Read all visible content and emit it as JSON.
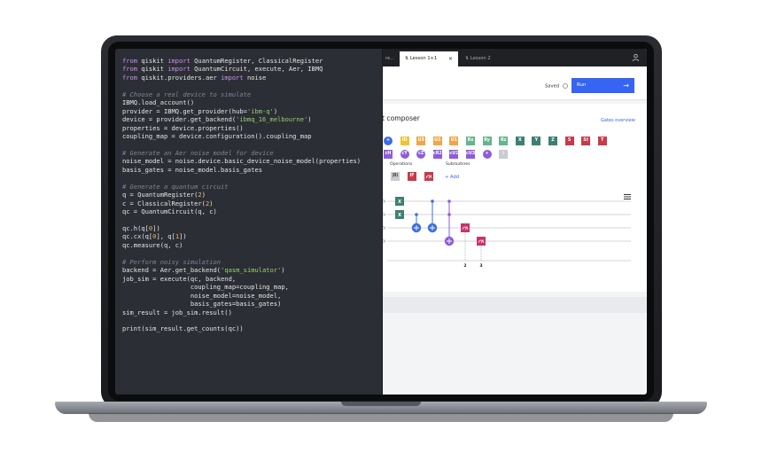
{
  "editor": {
    "code_lines": [
      [
        [
          "kw",
          "from"
        ],
        [
          "p",
          " qiskit "
        ],
        [
          "kw",
          "import"
        ],
        [
          "p",
          " QuantumRegister, ClassicalRegister"
        ]
      ],
      [
        [
          "kw",
          "from"
        ],
        [
          "p",
          " qiskit "
        ],
        [
          "kw",
          "import"
        ],
        [
          "p",
          " QuantumCircuit, execute, Aer, IBMQ"
        ]
      ],
      [
        [
          "kw",
          "from"
        ],
        [
          "p",
          " qiskit.providers.aer "
        ],
        [
          "kw",
          "import"
        ],
        [
          "p",
          " noise"
        ]
      ],
      [],
      [
        [
          "cm",
          "# Choose a real device to simulate"
        ]
      ],
      [
        [
          "p",
          "IBMQ.load_account()"
        ]
      ],
      [
        [
          "p",
          "provider = IBMQ.get_provider(hub="
        ],
        [
          "st",
          "'ibm-q'"
        ],
        [
          "p",
          ")"
        ]
      ],
      [
        [
          "p",
          "device = provider.get_backend("
        ],
        [
          "st",
          "'ibmq_16_melbourne'"
        ],
        [
          "p",
          ")"
        ]
      ],
      [
        [
          "p",
          "properties = device.properties()"
        ]
      ],
      [
        [
          "p",
          "coupling_map = device.configuration().coupling_map"
        ]
      ],
      [],
      [
        [
          "cm",
          "# Generate an Aer noise model for device"
        ]
      ],
      [
        [
          "p",
          "noise_model = noise.device.basic_device_noise_model(properties)"
        ]
      ],
      [
        [
          "p",
          "basis_gates = noise_model.basis_gates"
        ]
      ],
      [],
      [
        [
          "cm",
          "# Generate a quantum circuit"
        ]
      ],
      [
        [
          "p",
          "q = QuantumRegister("
        ],
        [
          "num",
          "2"
        ],
        [
          "p",
          ")"
        ]
      ],
      [
        [
          "p",
          "c = ClassicalRegister("
        ],
        [
          "num",
          "2"
        ],
        [
          "p",
          ")"
        ]
      ],
      [
        [
          "p",
          "qc = QuantumCircuit(q, c)"
        ]
      ],
      [],
      [
        [
          "p",
          "qc.h(q["
        ],
        [
          "num",
          "0"
        ],
        [
          "p",
          "])"
        ]
      ],
      [
        [
          "p",
          "qc.cx(q["
        ],
        [
          "num",
          "0"
        ],
        [
          "p",
          "], q["
        ],
        [
          "num",
          "1"
        ],
        [
          "p",
          "])"
        ]
      ],
      [
        [
          "p",
          "qc.measure(q, c)"
        ]
      ],
      [],
      [
        [
          "cm",
          "# Perform noisy simulation"
        ]
      ],
      [
        [
          "p",
          "backend = Aer.get_backend("
        ],
        [
          "st",
          "'qasm_simulator'"
        ],
        [
          "p",
          ")"
        ]
      ],
      [
        [
          "p",
          "job_sim = execute(qc, backend,"
        ]
      ],
      [
        [
          "p",
          "                  coupling_map=coupling_map,"
        ]
      ],
      [
        [
          "p",
          "                  noise_model=noise_model,"
        ]
      ],
      [
        [
          "p",
          "                  basis_gates=basis_gates)"
        ]
      ],
      [
        [
          "p",
          "sim_result = job_sim.result()"
        ]
      ],
      [],
      [
        [
          "p",
          "print(sim_result.get_counts(qc))"
        ]
      ]
    ]
  },
  "composer": {
    "tabs": [
      {
        "label": "re...",
        "active": false
      },
      {
        "label": "Lesson 1+1",
        "active": true,
        "close": "×"
      },
      {
        "label": "Lesson 2",
        "active": false
      }
    ],
    "saved_label": "Saved",
    "run_label": "Run",
    "title": "t composer",
    "gates_link": "Gates overview",
    "gate_row1": [
      {
        "label": "+",
        "color": "#3e6de0",
        "round": true
      },
      {
        "label": "ID",
        "color": "#f1c232",
        "round": false
      },
      {
        "label": "U3",
        "color": "#f1a64a",
        "round": false
      },
      {
        "label": "U2",
        "color": "#f1a64a",
        "round": false
      },
      {
        "label": "U1",
        "color": "#f1a64a",
        "round": false
      },
      {
        "label": "Rx",
        "color": "#67b48f",
        "round": false
      },
      {
        "label": "Ry",
        "color": "#67b48f",
        "round": false
      },
      {
        "label": "Rz",
        "color": "#67b48f",
        "round": false
      },
      {
        "label": "X",
        "color": "#3f7f73",
        "round": false
      },
      {
        "label": "Y",
        "color": "#3f7f73",
        "round": false
      },
      {
        "label": "Z",
        "color": "#3f7f73",
        "round": false
      },
      {
        "label": "S",
        "color": "#c73a4a",
        "round": false
      },
      {
        "label": "S†",
        "color": "#c73a4a",
        "round": false
      },
      {
        "label": "T",
        "color": "#c73a4a",
        "round": false
      }
    ],
    "gate_row2": [
      {
        "label": "cH",
        "color": "#8c5cdb",
        "round": false
      },
      {
        "label": "cY",
        "color": "#8c5cdb",
        "round": true
      },
      {
        "label": "cZ",
        "color": "#8c5cdb",
        "round": true
      },
      {
        "label": "cR2",
        "color": "#8c5cdb",
        "round": false
      },
      {
        "label": "cU1",
        "color": "#8c5cdb",
        "round": false
      },
      {
        "label": "cU3",
        "color": "#8c5cdb",
        "round": false
      },
      {
        "label": "+",
        "color": "#8c5cdb",
        "round": true
      },
      {
        "label": "⋮",
        "color": "#c9ccd1",
        "round": false
      }
    ],
    "operations_label": "Operations",
    "subroutines_label": "Subroutines",
    "operations": [
      {
        "label": "|0⟩",
        "color": "#c9ccd1"
      },
      {
        "label": "IF",
        "color": "#c73a4a"
      },
      {
        "label": "meter",
        "color": "#c73a4a"
      }
    ],
    "add_label": "+ Add",
    "qubit_labels": [
      "0⟩",
      "0⟩",
      "0⟩",
      "0⟩"
    ],
    "measure_labels": [
      "2",
      "3"
    ]
  }
}
